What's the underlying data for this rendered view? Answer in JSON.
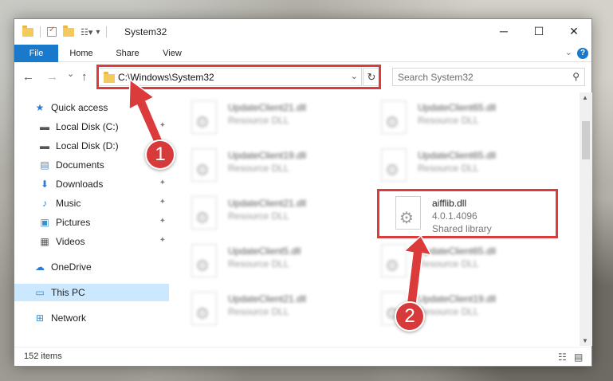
{
  "window": {
    "title": "System32",
    "controls": {
      "minimize": "─",
      "maximize": "☐",
      "close": "✕"
    }
  },
  "ribbon": {
    "tabs": [
      "File",
      "Home",
      "Share",
      "View"
    ],
    "help": "?"
  },
  "nav": {
    "back": "←",
    "forward": "→",
    "recent": "⌄",
    "up": "↑",
    "address": "C:\\Windows\\System32",
    "refresh": "↻",
    "search_placeholder": "Search System32"
  },
  "sidebar": {
    "items": [
      {
        "label": "Quick access",
        "icon": "★",
        "pinned": false
      },
      {
        "label": "Local Disk (C:)",
        "icon": "▬",
        "pinned": true
      },
      {
        "label": "Local Disk (D:)",
        "icon": "▬",
        "pinned": false
      },
      {
        "label": "Documents",
        "icon": "▤",
        "pinned": true
      },
      {
        "label": "Downloads",
        "icon": "⬇",
        "pinned": true
      },
      {
        "label": "Music",
        "icon": "♪",
        "pinned": true
      },
      {
        "label": "Pictures",
        "icon": "▣",
        "pinned": true
      },
      {
        "label": "Videos",
        "icon": "▦",
        "pinned": true
      },
      {
        "label": "OneDrive",
        "icon": "☁",
        "pinned": false
      },
      {
        "label": "This PC",
        "icon": "▭",
        "pinned": false,
        "selected": true
      },
      {
        "label": "Network",
        "icon": "⊞",
        "pinned": false
      }
    ],
    "pin_glyph": "📌"
  },
  "files": [
    {
      "name": "UpdateClient21.dll",
      "type": "Resource DLL"
    },
    {
      "name": "UpdateClient65.dll",
      "type": "Resource DLL"
    },
    {
      "name": "UpdateClient19.dll",
      "type": "Resource DLL"
    },
    {
      "name": "UpdateClient65.dll",
      "type": "Resource DLL"
    },
    {
      "name": "UpdateClient21.dll",
      "type": "Resource DLL"
    },
    {
      "name": "aifflib.dll",
      "version": "4.0.1.4096",
      "type": "Shared library",
      "highlighted": true
    },
    {
      "name": "UpdateClient5.dll",
      "type": "Resource DLL"
    },
    {
      "name": "UpdateClient65.dll",
      "type": "Resource DLL"
    },
    {
      "name": "UpdateClient21.dll",
      "type": "Resource DLL"
    },
    {
      "name": "UpdateClient19.dll",
      "type": "Resource DLL"
    }
  ],
  "status": {
    "count": "152 items"
  },
  "annotations": {
    "badge1": "1",
    "badge2": "2",
    "color": "#dc3b3b"
  }
}
